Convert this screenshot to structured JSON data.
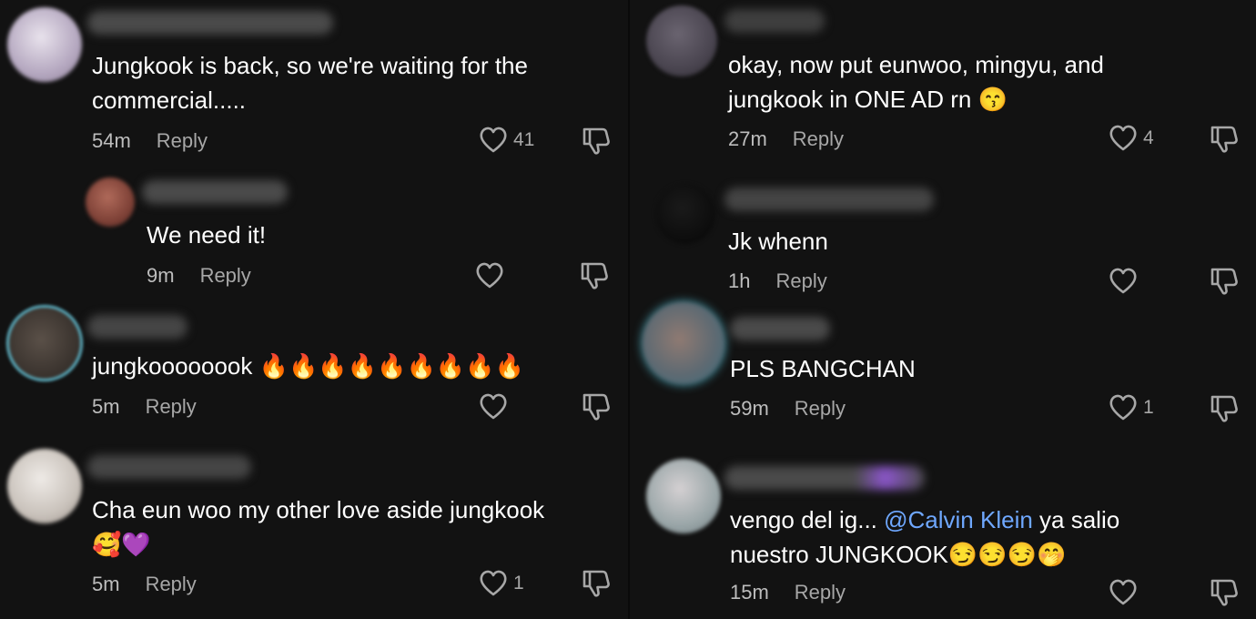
{
  "left": [
    {
      "text": "Jungkook is back, so we're waiting for the\ncommercial.....",
      "time": "54m",
      "reply": "Reply",
      "likes": "41"
    },
    {
      "text": "We need it!",
      "time": "9m",
      "reply": "Reply",
      "likes": ""
    },
    {
      "text": "jungkoooooook 🔥🔥🔥🔥🔥🔥🔥🔥🔥",
      "time": "5m",
      "reply": "Reply",
      "likes": ""
    },
    {
      "text": "Cha eun woo my other love aside jungkook\n🥰💜",
      "time": "5m",
      "reply": "Reply",
      "likes": "1"
    }
  ],
  "right": [
    {
      "text": "okay, now put eunwoo, mingyu, and\njungkook in ONE AD rn 😙",
      "time": "27m",
      "reply": "Reply",
      "likes": "4"
    },
    {
      "text": "Jk whenn",
      "time": "1h",
      "reply": "Reply",
      "likes": ""
    },
    {
      "text": "PLS BANGCHAN",
      "time": "59m",
      "reply": "Reply",
      "likes": "1"
    },
    {
      "text_before": "vengo del ig... ",
      "mention": "@Calvin Klein",
      "text_after": " ya salio\nnuestro JUNGKOOK😏😏😏🤭",
      "time": "15m",
      "reply": "Reply",
      "likes": ""
    }
  ],
  "colors": {
    "background": "#121212",
    "meta": "#a7a7a7",
    "mention": "#6fa8ff"
  },
  "icons": {
    "like": "heart-outline-icon",
    "dislike": "thumbs-down-icon"
  }
}
